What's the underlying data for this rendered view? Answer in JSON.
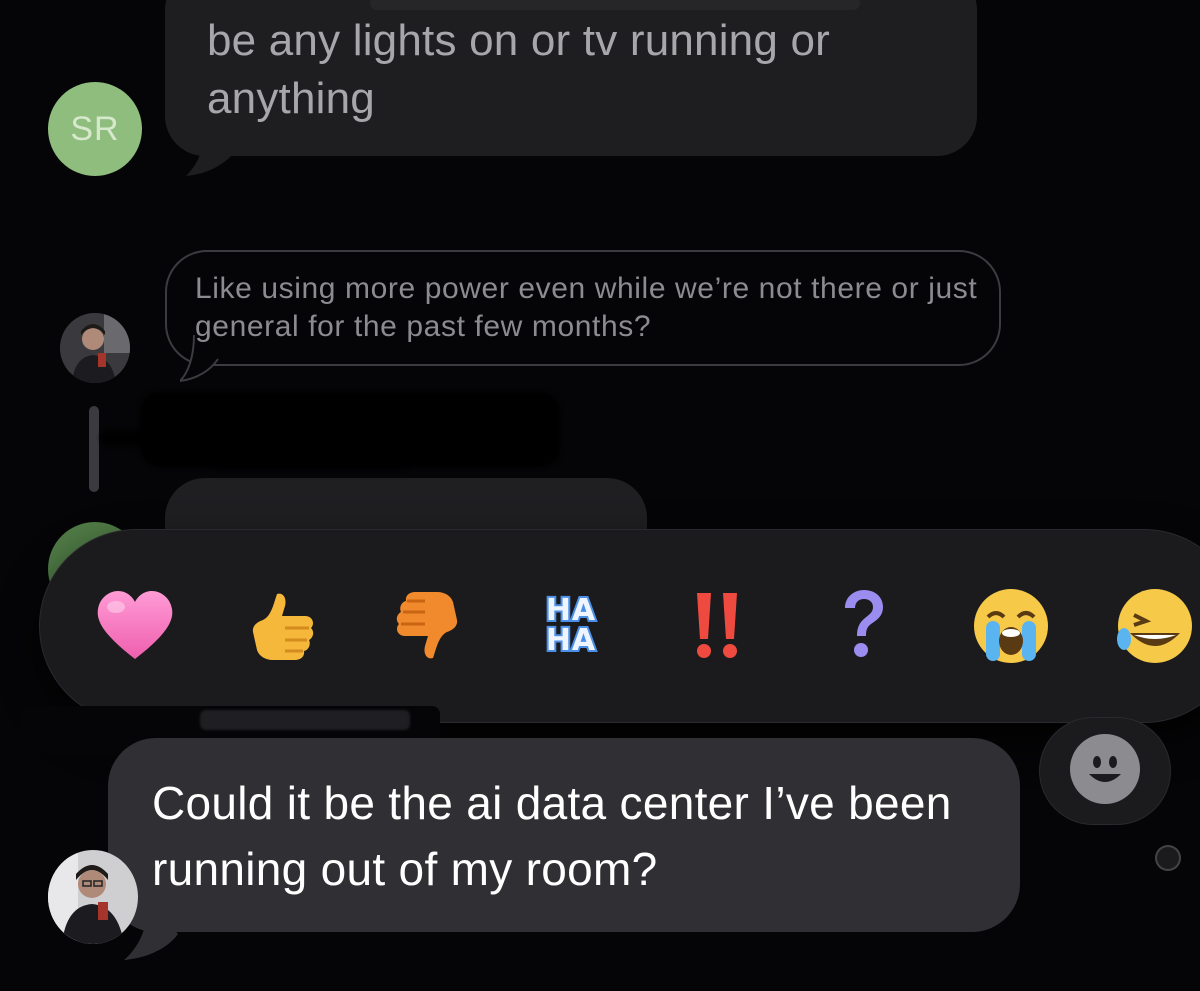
{
  "messages": [
    {
      "sender_initials": "SR",
      "text": "be any lights on or tv running or anything"
    },
    {
      "text": "Like using more power even while we’re not there or just general for the past few months?"
    },
    {
      "text": "Could it be the ai data center I’ve been running out of my room?"
    }
  ],
  "reactions": [
    {
      "name": "heart",
      "icon": "heart-icon",
      "color": "#f07bc0"
    },
    {
      "name": "thumbs-up",
      "icon": "thumbs-up-icon",
      "color": "#f5b83a"
    },
    {
      "name": "thumbs-down",
      "icon": "thumbs-down-icon",
      "color": "#f08a2c"
    },
    {
      "name": "haha",
      "label_top": "HA",
      "label_bottom": "HA",
      "color": "#4a90e8"
    },
    {
      "name": "emphasize",
      "icon": "double-exclamation-icon",
      "color": "#e8423a"
    },
    {
      "name": "question",
      "icon": "question-mark-icon",
      "color": "#9a8cf0"
    },
    {
      "name": "crying",
      "icon": "crying-face-icon",
      "color": "#f7c948"
    },
    {
      "name": "laughing",
      "icon": "laughing-face-icon",
      "color": "#f7c948"
    }
  ],
  "add_reaction": {
    "icon": "smiley-icon"
  },
  "colors": {
    "background": "#050507",
    "bubble_incoming": "#303034",
    "avatar_sr": "#8fbd7d"
  }
}
